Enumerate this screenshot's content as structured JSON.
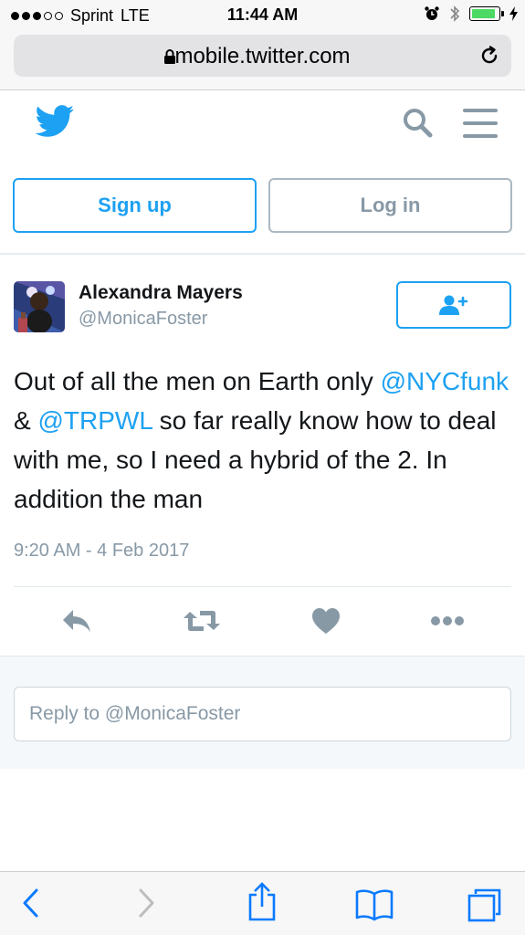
{
  "status_bar": {
    "carrier": "Sprint",
    "network": "LTE",
    "time": "11:44 AM",
    "signal_bars": 3,
    "signal_total": 5,
    "battery_level": 0.9
  },
  "browser": {
    "url": "mobile.twitter.com"
  },
  "header": {
    "logo": "twitter-bird-icon",
    "search_icon": "search-icon",
    "menu_icon": "menu-icon"
  },
  "auth": {
    "signup_label": "Sign up",
    "login_label": "Log in"
  },
  "tweet": {
    "author_name": "Alexandra Mayers",
    "author_handle": "@MonicaFoster",
    "text_parts": {
      "p1": "Out of all the men on Earth only ",
      "m1": "@NYCfunk",
      "p2": " & ",
      "m2": "@TRPWL",
      "p3": " so far really know how to deal with me, so I need a hybrid of the 2. In addition the man"
    },
    "timestamp": "9:20 AM - 4 Feb 2017"
  },
  "reply": {
    "placeholder": "Reply to @MonicaFoster"
  },
  "colors": {
    "twitter_blue": "#1da1f2",
    "gray_text": "#8899a6",
    "icon_gray": "#8899a6",
    "safari_blue": "#0a7aff"
  }
}
